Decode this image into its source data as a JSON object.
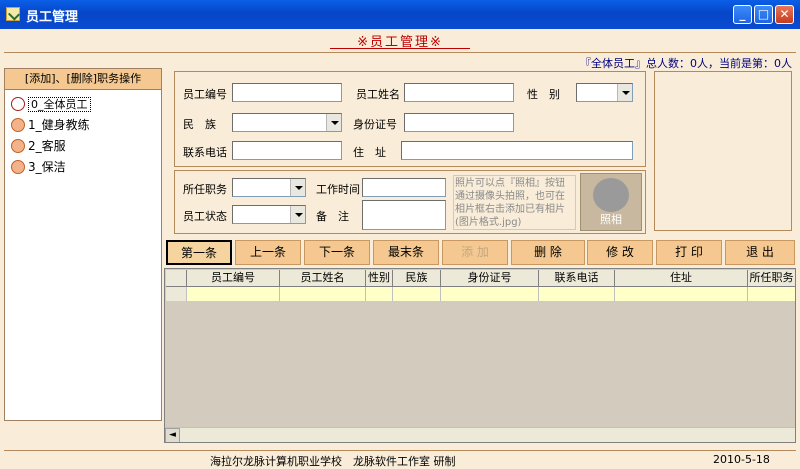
{
  "window": {
    "title": "员工管理"
  },
  "header": {
    "title": "※员工管理※",
    "status": "『全体员工』总人数：0人，当前是第：0人"
  },
  "left_panel": {
    "header": "[添加]、[删除]职务操作",
    "items": [
      {
        "label": "0_全体员工",
        "selected": true
      },
      {
        "label": "1_健身教练"
      },
      {
        "label": "2_客服"
      },
      {
        "label": "3_保洁"
      }
    ]
  },
  "form": {
    "emp_no_label": "员工编号",
    "emp_no_value": "",
    "name_label": "员工姓名",
    "name_value": "",
    "gender_label": "性　别",
    "gender_value": "",
    "ethnicity_label": "民　族",
    "ethnicity_value": "",
    "id_label": "身份证号",
    "id_value": "",
    "phone_label": "联系电话",
    "phone_value": "",
    "address_label": "住　址",
    "address_value": "",
    "position_label": "所任职务",
    "position_value": "",
    "work_time_label": "工作时间",
    "work_time_value": "",
    "status_label": "员工状态",
    "status_value": "",
    "remark_label": "备　注",
    "remark_value": ""
  },
  "photo": {
    "hint": "照片可以点『照相』按钮通过摄像头拍照，也可在相片框右击添加已有相片(图片格式.jpg)",
    "button_label": "照相"
  },
  "toolbar": {
    "first": "第一条",
    "prev": "上一条",
    "next": "下一条",
    "last": "最末条",
    "add": "添 加",
    "delete": "删 除",
    "edit": "修 改",
    "print": "打 印",
    "exit": "退 出"
  },
  "grid": {
    "columns": [
      "员工编号",
      "员工姓名",
      "性别",
      "民族",
      "身份证号",
      "联系电话",
      "住址",
      "所任职务"
    ]
  },
  "footer": {
    "credit": "海拉尔龙脉计算机职业学校　龙脉软件工作室 研制",
    "date": "2010-5-18"
  }
}
